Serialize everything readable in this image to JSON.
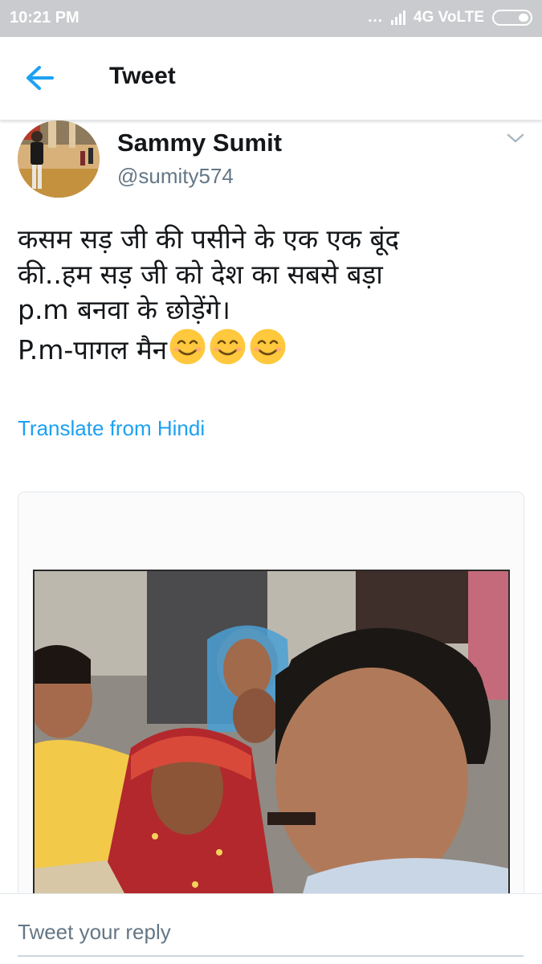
{
  "status_bar": {
    "time": "10:21 PM",
    "dots": "...",
    "network": "4G VoLTE",
    "battery_icon": "battery-icon"
  },
  "header": {
    "title": "Tweet",
    "back_icon": "back-arrow-icon"
  },
  "tweet": {
    "user_name": "Sammy Sumit",
    "handle": "@sumity574",
    "lines": [
      "कसम सड़ जी की पसीने के एक एक बूंद",
      "की..हम सड़ जी को देश का  सबसे बड़ा",
      "p.m बनवा के छोड़ेंगे।",
      "P.m-पागल मैन"
    ],
    "emoji_name": "smiling-face-with-smiling-eyes",
    "emoji_count": 3,
    "translate_label": "Translate from Hindi"
  },
  "reply": {
    "placeholder": "Tweet your reply"
  },
  "colors": {
    "accent": "#1da1f2",
    "secondary_text": "#657786",
    "status_bar_bg": "#c9cbce"
  }
}
